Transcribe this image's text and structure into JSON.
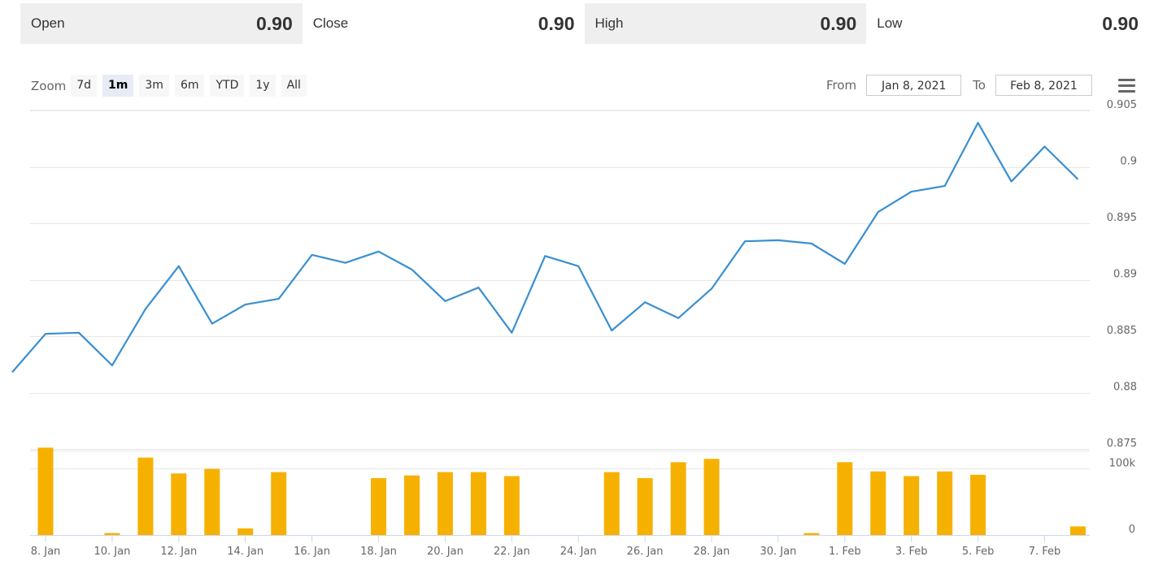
{
  "stats": [
    {
      "label": "Open",
      "value": "0.90"
    },
    {
      "label": "Close",
      "value": "0.90"
    },
    {
      "label": "High",
      "value": "0.90"
    },
    {
      "label": "Low",
      "value": "0.90"
    }
  ],
  "zoom": {
    "label": "Zoom",
    "buttons": [
      "7d",
      "1m",
      "3m",
      "6m",
      "YTD",
      "1y",
      "All"
    ],
    "active": "1m"
  },
  "range": {
    "from_label": "From",
    "from_value": "Jan 8, 2021",
    "to_label": "To",
    "to_value": "Feb 8, 2021"
  },
  "menu_icon": "hamburger-menu-icon",
  "colors": {
    "line": "#3a8fd0",
    "bars": "#f6b100",
    "grid": "#e6e6e6"
  },
  "chart_data": [
    {
      "type": "line",
      "ylim": [
        0.875,
        0.905
      ],
      "yticks": [
        "0.905",
        "0.9",
        "0.895",
        "0.89",
        "0.885",
        "0.88",
        "0.875"
      ],
      "yticks_values": [
        0.905,
        0.9,
        0.895,
        0.89,
        0.885,
        0.88,
        0.875
      ],
      "x": [
        "2021-01-07",
        "2021-01-08",
        "2021-01-09",
        "2021-01-10",
        "2021-01-11",
        "2021-01-12",
        "2021-01-13",
        "2021-01-14",
        "2021-01-15",
        "2021-01-16",
        "2021-01-17",
        "2021-01-18",
        "2021-01-19",
        "2021-01-20",
        "2021-01-21",
        "2021-01-22",
        "2021-01-23",
        "2021-01-24",
        "2021-01-25",
        "2021-01-26",
        "2021-01-27",
        "2021-01-28",
        "2021-01-29",
        "2021-01-30",
        "2021-01-31",
        "2021-02-01",
        "2021-02-02",
        "2021-02-03",
        "2021-02-04",
        "2021-02-05",
        "2021-02-06",
        "2021-02-07",
        "2021-02-08"
      ],
      "values": [
        0.8818,
        0.8852,
        0.8853,
        0.8824,
        0.8874,
        0.8912,
        0.8861,
        0.8878,
        0.8883,
        0.8922,
        0.8915,
        0.8925,
        0.8909,
        0.8881,
        0.8893,
        0.8853,
        0.8921,
        0.8912,
        0.8855,
        0.888,
        0.8866,
        0.8892,
        0.8934,
        0.8935,
        0.8932,
        0.8914,
        0.896,
        0.8978,
        0.8983,
        0.9039,
        0.8987,
        0.9018,
        0.8989
      ]
    },
    {
      "type": "bar",
      "ylim": [
        0,
        130000
      ],
      "yticks": [
        "100k",
        "0"
      ],
      "yticks_values": [
        100000,
        0
      ],
      "x": [
        "2021-01-08",
        "2021-01-10",
        "2021-01-11",
        "2021-01-12",
        "2021-01-13",
        "2021-01-14",
        "2021-01-15",
        "2021-01-18",
        "2021-01-19",
        "2021-01-20",
        "2021-01-21",
        "2021-01-22",
        "2021-01-25",
        "2021-01-26",
        "2021-01-27",
        "2021-01-28",
        "2021-01-31",
        "2021-02-01",
        "2021-02-02",
        "2021-02-03",
        "2021-02-04",
        "2021-02-05",
        "2021-02-08"
      ],
      "values": [
        132000,
        3000,
        117000,
        93000,
        100000,
        10000,
        95000,
        86000,
        90000,
        95000,
        95000,
        89000,
        95000,
        86000,
        110000,
        115000,
        3000,
        110000,
        96000,
        89000,
        96000,
        91000,
        13000
      ]
    }
  ],
  "xaxis": {
    "ticks": [
      "8. Jan",
      "10. Jan",
      "12. Jan",
      "14. Jan",
      "16. Jan",
      "18. Jan",
      "20. Jan",
      "22. Jan",
      "24. Jan",
      "26. Jan",
      "28. Jan",
      "30. Jan",
      "1. Feb",
      "3. Feb",
      "5. Feb",
      "7. Feb"
    ],
    "tick_dates": [
      "2021-01-08",
      "2021-01-10",
      "2021-01-12",
      "2021-01-14",
      "2021-01-16",
      "2021-01-18",
      "2021-01-20",
      "2021-01-22",
      "2021-01-24",
      "2021-01-26",
      "2021-01-28",
      "2021-01-30",
      "2021-02-01",
      "2021-02-03",
      "2021-02-05",
      "2021-02-07"
    ]
  }
}
